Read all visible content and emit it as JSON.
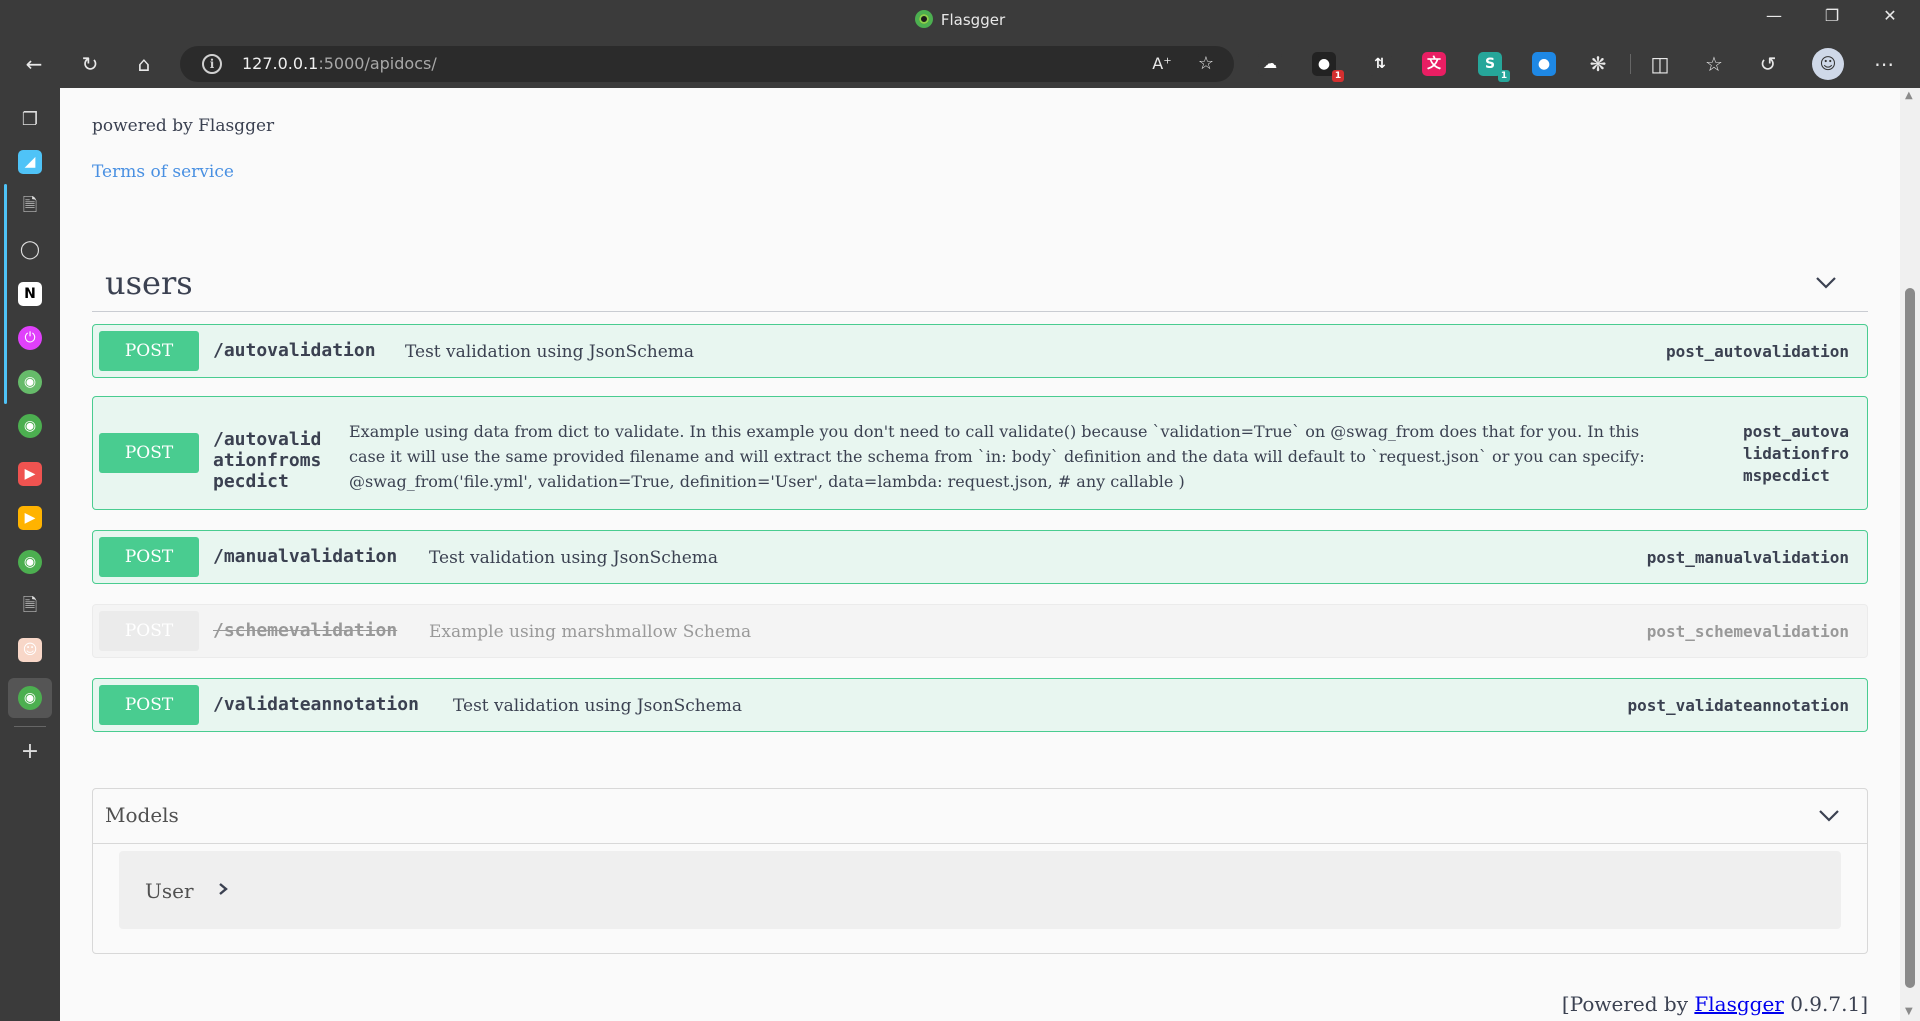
{
  "window": {
    "title": "Flasgger"
  },
  "toolbar": {
    "url_host": "127.0.0.1",
    "url_rest": ":5000/apidocs/",
    "extensions": [
      {
        "name": "cloud-extension-icon",
        "glyph": "☁",
        "color": "#3b3b3b",
        "badge": ""
      },
      {
        "name": "mail-extension-icon",
        "glyph": "●",
        "color": "#222222",
        "badge": "1"
      },
      {
        "name": "sort-extension-icon",
        "glyph": "⇅",
        "color": "#3b3b3b",
        "badge": ""
      },
      {
        "name": "translate-extension-icon",
        "glyph": "文",
        "color": "#e91e63",
        "badge": ""
      },
      {
        "name": "s-extension-icon",
        "glyph": "S",
        "color": "#26a69a",
        "badge": "1"
      },
      {
        "name": "blue-dot-extension-icon",
        "glyph": "●",
        "color": "#1e88e5",
        "badge": ""
      }
    ]
  },
  "page": {
    "powered_text": "powered by Flasgger",
    "tos_link": "Terms of service",
    "tag": {
      "name": "users"
    },
    "operations": [
      {
        "method": "POST",
        "path": "/autovalidation",
        "summary": "Test validation using JsonSchema",
        "operation_id": "post_autovalidation",
        "deprecated": false
      },
      {
        "method": "POST",
        "path_lines": [
          "/autovalid",
          "ationfroms",
          "pecdict"
        ],
        "summary_lines": [
          "Example using data from dict to validate. In this example you don't need to call validate() because `validation=True` on @swag_from does that for you. In this",
          "case it will use the same provided filename and will extract the schema from `in: body` definition and the data will default to `request.json` or you can specify:",
          "@swag_from('file.yml', validation=True, definition='User', data=lambda: request.json, # any callable )"
        ],
        "operation_id_lines": [
          "post_autova",
          "lidationfro",
          "mspecdict"
        ],
        "deprecated": false
      },
      {
        "method": "POST",
        "path": "/manualvalidation",
        "summary": "Test validation using JsonSchema",
        "operation_id": "post_manualvalidation",
        "deprecated": false
      },
      {
        "method": "POST",
        "path": "/schemevalidation",
        "summary": "Example using marshmallow Schema",
        "operation_id": "post_schemevalidation",
        "deprecated": true
      },
      {
        "method": "POST",
        "path": "/validateannotation",
        "summary": "Test validation using JsonSchema",
        "operation_id": "post_validateannotation",
        "deprecated": false
      }
    ],
    "models": {
      "title": "Models",
      "items": [
        {
          "name": "User"
        }
      ]
    },
    "footer": {
      "prefix": "[Powered by ",
      "link": "Flasgger",
      "suffix": " 0.9.7.1]"
    }
  },
  "colors": {
    "post": "#49cc90",
    "post_bg": "#e8f6f0",
    "link": "#4990e2"
  }
}
